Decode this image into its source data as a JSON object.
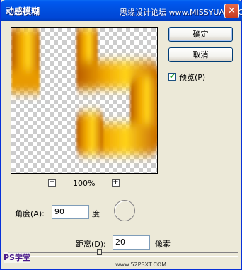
{
  "window": {
    "title": "动感模糊",
    "watermark_top": "思缘设计论坛 www.MISSYUAN.COM",
    "close_label": "✕"
  },
  "preview": {
    "zoom_minus": "−",
    "zoom_level": "100%",
    "zoom_plus": "+"
  },
  "buttons": {
    "ok": "确定",
    "cancel": "取消"
  },
  "preview_toggle": {
    "label": "预览(P)",
    "checked": true,
    "check_glyph": "✔"
  },
  "angle": {
    "label": "角度(A):",
    "value": "90",
    "unit": "度"
  },
  "distance": {
    "label": "距离(D):",
    "value": "20",
    "unit": "像素"
  },
  "watermarks": {
    "bottom_left": "PS学堂",
    "bottom_right": "www.52PSXT.COM"
  }
}
